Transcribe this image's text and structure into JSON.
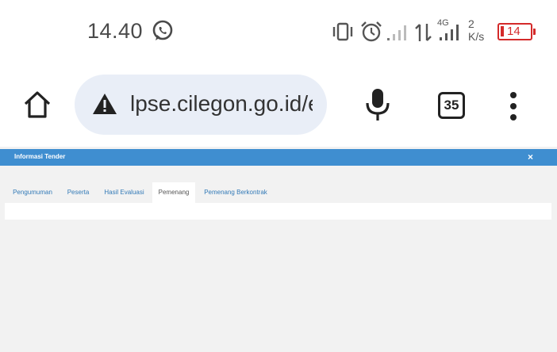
{
  "status_bar": {
    "time": "14.40",
    "network_type": "4G",
    "speed_value": "2",
    "speed_unit": "K/s",
    "battery_level": "14",
    "battery_color": "#d42a2a",
    "icons": [
      "whatsapp-icon",
      "vibrate-icon",
      "alarm-icon",
      "signal-icon",
      "data-arrows-icon",
      "signal-4g-icon",
      "battery-icon"
    ]
  },
  "browser": {
    "url": "lpse.cilegon.go.id/ep",
    "tab_count": "35",
    "icons": [
      "home-icon",
      "warning-icon",
      "mic-icon",
      "tabs-icon",
      "menu-icon"
    ],
    "url_bar_color": "#e9eef7"
  },
  "dialog": {
    "title": "Informasi Tender",
    "close_label": "×",
    "header_color": "#3f8ed0",
    "tabs": [
      {
        "label": "Pengumuman",
        "active": false
      },
      {
        "label": "Peserta",
        "active": false
      },
      {
        "label": "Hasil Evaluasi",
        "active": false
      },
      {
        "label": "Pemenang",
        "active": true
      },
      {
        "label": "Pemenang Berkontrak",
        "active": false
      }
    ]
  }
}
